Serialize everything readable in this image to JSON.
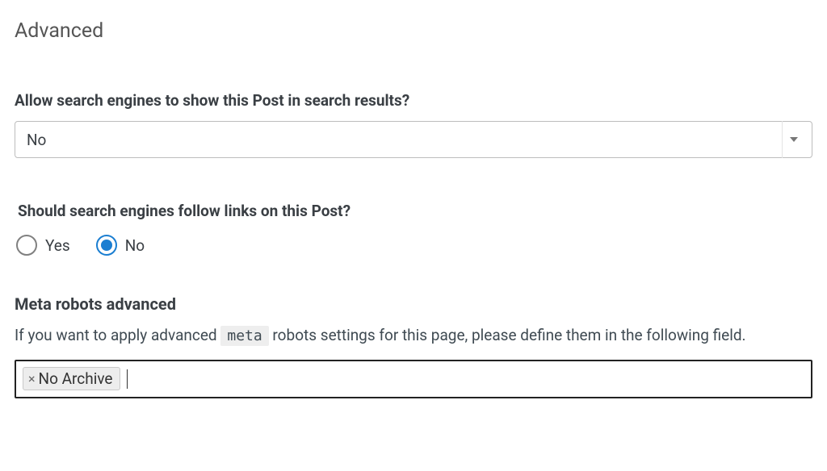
{
  "section": {
    "title": "Advanced"
  },
  "allowSearch": {
    "label": "Allow search engines to show this Post in search results?",
    "value": "No"
  },
  "followLinks": {
    "label": "Should search engines follow links on this Post?",
    "options": {
      "yes": "Yes",
      "no": "No"
    },
    "selected": "no"
  },
  "metaRobots": {
    "label": "Meta robots advanced",
    "helper_pre": "If you want to apply advanced ",
    "helper_code": "meta",
    "helper_post": " robots settings for this page, please define them in the following field.",
    "tags": [
      {
        "label": "No Archive"
      }
    ]
  }
}
